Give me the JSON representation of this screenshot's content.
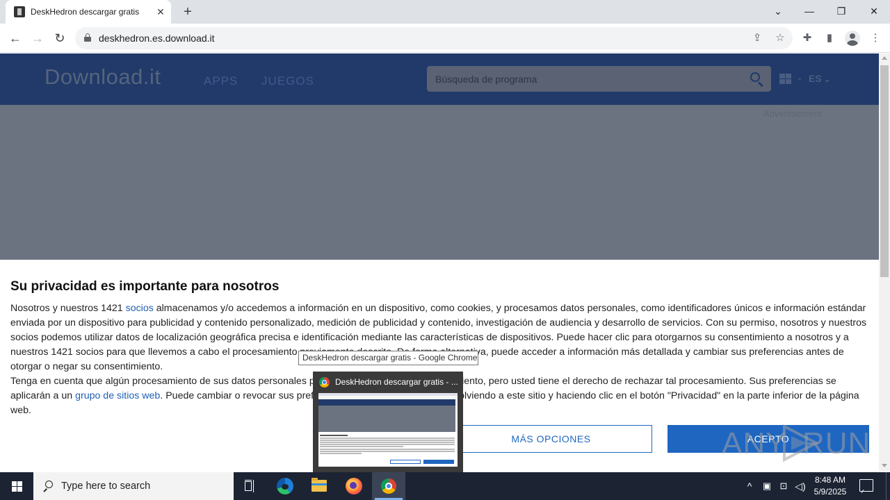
{
  "browser": {
    "tab": {
      "title": "DeskHedron descargar gratis",
      "close_glyph": "✕"
    },
    "new_tab_glyph": "+",
    "window_controls": {
      "dropdown": "⌄",
      "minimize": "—",
      "restore": "❐",
      "close": "✕"
    },
    "nav": {
      "back": "←",
      "forward": "→",
      "reload": "↻"
    },
    "url": "deskhedron.es.download.it",
    "icons": [
      "lock-icon",
      "share-icon",
      "bookmark-star-icon",
      "extensions-icon",
      "side-panel-icon",
      "profile-icon",
      "menu-icon"
    ]
  },
  "site": {
    "logo": "Download.it",
    "nav": [
      "APPS",
      "JUEGOS"
    ],
    "search": {
      "placeholder": "Búsqueda de programa"
    },
    "language": "ES",
    "advertisement_label": "Advertisement"
  },
  "consent": {
    "heading": "Su privacidad es importante para nosotros",
    "p1_before": "Nosotros y nuestros 1421 ",
    "p1_link": "socios",
    "p1_after": " almacenamos y/o accedemos a información en un dispositivo, como cookies, y procesamos datos personales, como identificadores únicos e información estándar enviada por un dispositivo para publicidad y contenido personalizado, medición de publicidad y contenido, investigación de audiencia y desarrollo de servicios. Con su permiso, nosotros y nuestros socios podemos utilizar datos de localización geográfica precisa e identificación mediante las características de dispositivos. Puede hacer clic para otorgarnos su consentimiento a nosotros y a nuestros 1421 socios para que llevemos a cabo el procesamiento previamente descrito. De forma alternativa, puede acceder a información más detallada y cambiar sus preferencias antes de otorgar o negar su consentimiento.",
    "p2_before": "Tenga en cuenta que algún procesamiento de sus datos personales puede no requerir de su consentimiento, pero usted tiene el derecho de rechazar tal procesamiento. Sus preferencias se aplicarán a un ",
    "p2_link": "grupo de sitios web",
    "p2_after": ". Puede cambiar o revocar sus preferencias en cualquier momento volviendo a este sitio y haciendo clic en el botón \"Privacidad\" en la parte inferior de la página web.",
    "btn_more": "MÁS OPCIONES",
    "btn_accept": "ACEPTO"
  },
  "tooltip": "DeskHedron descargar gratis - Google Chrome",
  "thumbnail": {
    "title": "DeskHedron descargar gratis - ..."
  },
  "watermark": {
    "left": "ANY",
    "right": "RUN"
  },
  "taskbar": {
    "search_placeholder": "Type here to search",
    "apps": [
      "task-view",
      "edge",
      "file-explorer",
      "firefox",
      "chrome"
    ],
    "tray": {
      "chevron": "^",
      "time": "8:48 AM",
      "date": "5/9/2025"
    }
  }
}
